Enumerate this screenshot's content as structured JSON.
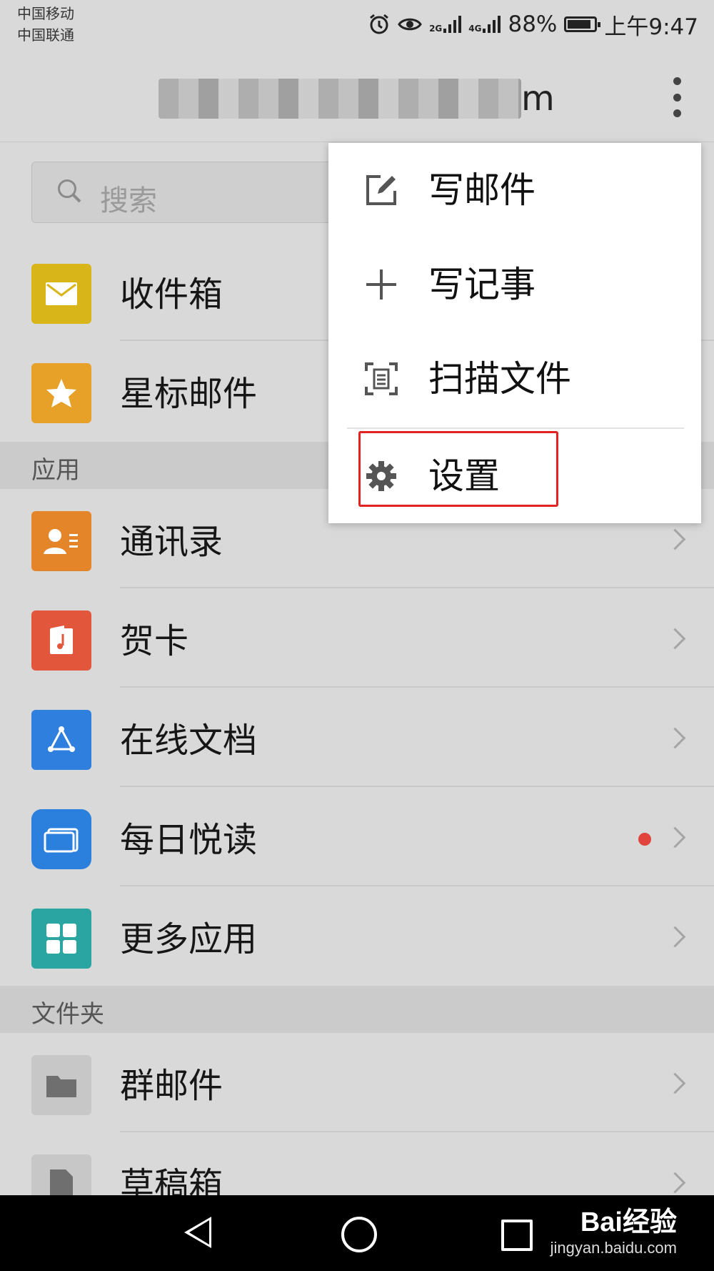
{
  "status_bar": {
    "carrier1": "中国移动",
    "carrier2": "中国联通",
    "net1": "2G",
    "net2": "4G",
    "battery_percent": "88%",
    "battery_level": 0.88,
    "time": "上午9:47"
  },
  "header": {
    "account_suffix": "m",
    "more_icon": "more-vertical-icon"
  },
  "search": {
    "placeholder": "搜索"
  },
  "mailboxes": [
    {
      "label": "收件箱",
      "icon": "mail-icon",
      "color": "#d8b518"
    },
    {
      "label": "星标邮件",
      "icon": "star-icon",
      "color": "#e7a128"
    }
  ],
  "apps_section": {
    "title": "应用"
  },
  "apps": [
    {
      "label": "通讯录",
      "icon": "contacts-icon",
      "color": "#e5852a"
    },
    {
      "label": "贺卡",
      "icon": "greeting-card-icon",
      "color": "#e2573b"
    },
    {
      "label": "在线文档",
      "icon": "online-doc-icon",
      "color": "#2f80de"
    },
    {
      "label": "每日悦读",
      "icon": "daily-reading-icon",
      "color": "#2b7fdd",
      "has_dot": true
    },
    {
      "label": "更多应用",
      "icon": "more-apps-icon",
      "color": "#2aa5a2"
    }
  ],
  "folders_section": {
    "title": "文件夹"
  },
  "folders": [
    {
      "label": "群邮件",
      "icon": "folder-icon",
      "color": "#c7c7c7"
    },
    {
      "label": "草稿箱",
      "icon": "draft-icon",
      "color": "#c7c7c7"
    }
  ],
  "menu": {
    "items": [
      {
        "label": "写邮件",
        "icon": "compose-icon"
      },
      {
        "label": "写记事",
        "icon": "plus-icon"
      },
      {
        "label": "扫描文件",
        "icon": "scan-icon"
      },
      {
        "label": "设置",
        "icon": "gear-icon"
      }
    ],
    "highlight_color": "#e32222"
  },
  "watermark": {
    "main": "Bai经验",
    "sub": "jingyan.baidu.com"
  }
}
